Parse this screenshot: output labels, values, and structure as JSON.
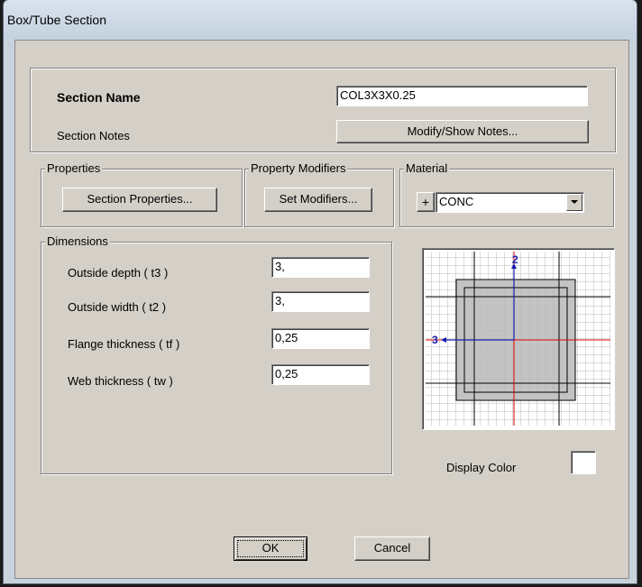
{
  "window": {
    "title": "Box/Tube Section"
  },
  "section": {
    "name_label": "Section Name",
    "name_value": "COL3X3X0.25",
    "notes_label": "Section Notes",
    "notes_button": "Modify/Show Notes..."
  },
  "properties": {
    "group_label": "Properties",
    "button": "Section Properties..."
  },
  "modifiers": {
    "group_label": "Property Modifiers",
    "button": "Set Modifiers..."
  },
  "material": {
    "group_label": "Material",
    "plus": "+",
    "selected": "CONC"
  },
  "dimensions": {
    "group_label": "Dimensions",
    "rows": [
      {
        "label": "Outside depth  ( t3 )",
        "value": "3,"
      },
      {
        "label": "Outside width  ( t2 )",
        "value": "3,"
      },
      {
        "label": "Flange thickness  ( tf )",
        "value": "0,25"
      },
      {
        "label": "Web thickness  ( tw )",
        "value": "0,25"
      }
    ]
  },
  "preview": {
    "axis_2": "2",
    "axis_3": "3"
  },
  "display_color_label": "Display Color",
  "buttons": {
    "ok": "OK",
    "cancel": "Cancel"
  }
}
